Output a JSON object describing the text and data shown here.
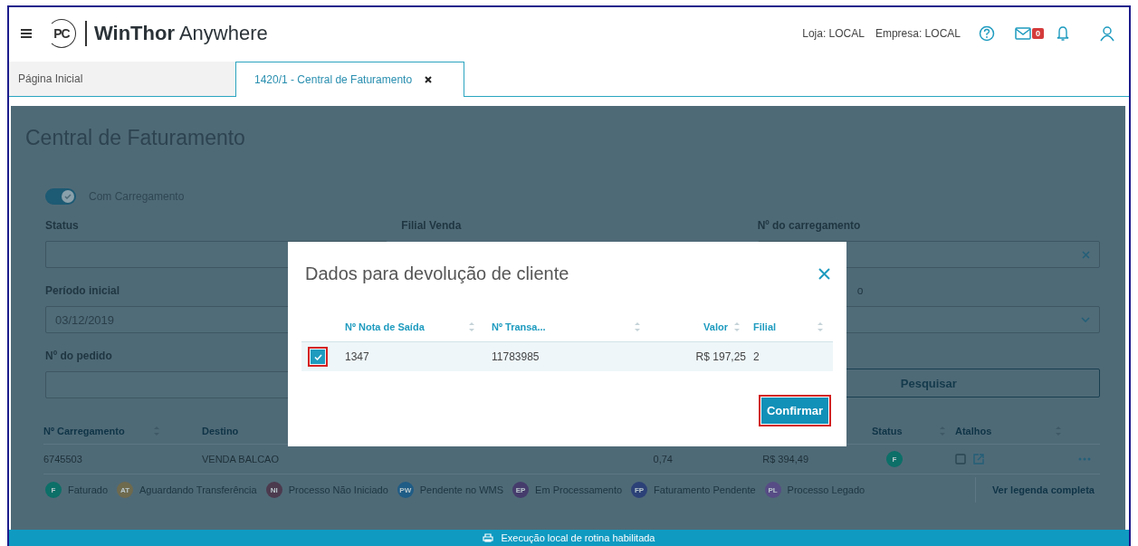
{
  "header": {
    "logo_text": "PC",
    "app_name_bold": "WinThor",
    "app_name": "Anywhere",
    "store": "Loja: LOCAL",
    "company": "Empresa: LOCAL",
    "mail_badge": "0"
  },
  "tabs": [
    {
      "label": "Página Inicial",
      "selected": false,
      "closable": false
    },
    {
      "label": "1420/1 - Central de Faturamento",
      "selected": true,
      "closable": true
    }
  ],
  "page": {
    "title": "Central de Faturamento",
    "toggle": {
      "label": "Com Carregamento",
      "on": true
    },
    "filter_rows": [
      [
        {
          "label": "Status",
          "kind": "text"
        },
        {
          "label": "Filial Venda",
          "kind": "none"
        },
        {
          "label": "Nº do carregamento",
          "kind": "clearable"
        }
      ],
      [
        {
          "label": "Período inicial",
          "kind": "text",
          "value": "03/12/2019"
        },
        {
          "kind": "none"
        },
        {
          "label_tail": "o",
          "kind": "select"
        }
      ],
      [
        {
          "label": "Nº do pedido",
          "kind": "text"
        },
        {
          "kind": "none"
        },
        {
          "kind": "button",
          "button_label": "Pesquisar"
        }
      ]
    ],
    "table": {
      "columns": [
        {
          "label": "Nº Carregamento"
        },
        {
          "label": "Destino"
        },
        {
          "label": "Status"
        },
        {
          "label": "Atalhos"
        }
      ],
      "rows": [
        {
          "carregamento": "6745503",
          "destino": "VENDA BALCAO",
          "column_3": "0,74",
          "column_4": "R$ 394,49",
          "status": {
            "label": "F",
            "color": "#0c6f68"
          }
        }
      ]
    },
    "legend": [
      {
        "abbr": "F",
        "label": "Faturado",
        "color": "#0c6f68"
      },
      {
        "abbr": "AT",
        "label": "Aguardando Transferência",
        "color": "#6e6a4e"
      },
      {
        "abbr": "NI",
        "label": "Processo Não Iniciado",
        "color": "#4c3a4e"
      },
      {
        "abbr": "PW",
        "label": "Pendente no WMS",
        "color": "#1f5c86"
      },
      {
        "abbr": "EP",
        "label": "Em Processamento",
        "color": "#453c6c"
      },
      {
        "abbr": "FP",
        "label": "Faturamento Pendente",
        "color": "#2c4177"
      },
      {
        "abbr": "PL",
        "label": "Processo Legado",
        "color": "#574c85"
      }
    ],
    "legend_link": "Ver legenda completa"
  },
  "modal": {
    "title": "Dados para devolução de cliente",
    "columns": [
      {
        "label": "Nº Nota de Saída"
      },
      {
        "label": "Nº Transa..."
      },
      {
        "label": "Valor"
      },
      {
        "label": "Filial"
      }
    ],
    "rows": [
      {
        "checked": true,
        "highlighted": true,
        "nota": "1347",
        "transacao": "11783985",
        "valor": "R$ 197,25",
        "filial": "2"
      }
    ],
    "confirm": {
      "label": "Confirmar",
      "highlighted": true
    }
  },
  "status_bar": {
    "text": "Execução local de rotina habilitada"
  }
}
